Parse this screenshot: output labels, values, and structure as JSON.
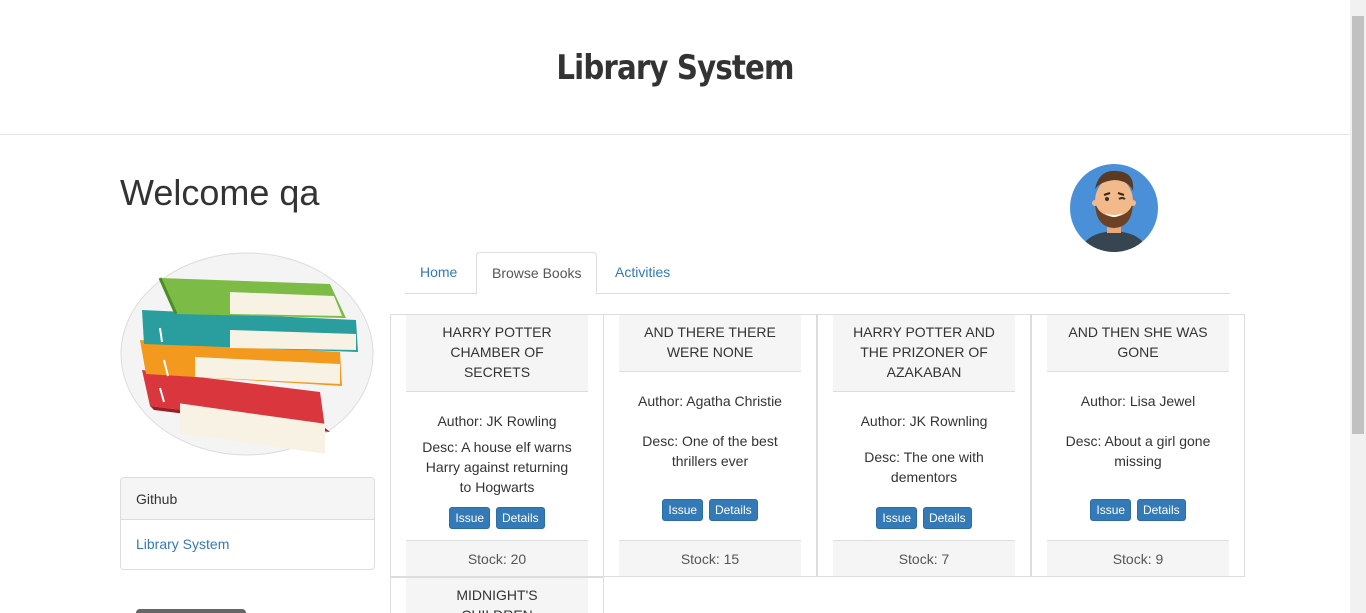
{
  "header": {
    "title": "Library System"
  },
  "welcome": "Welcome qa",
  "tabs": [
    {
      "label": "Home"
    },
    {
      "label": "Browse Books"
    },
    {
      "label": "Activities"
    }
  ],
  "github": {
    "heading": "Github",
    "link": "Library System"
  },
  "books": [
    {
      "title": "HARRY POTTER CHAMBER OF SECRETS",
      "author": "Author: JK Rowling",
      "desc": "Desc: A house elf warns Harry against returning to Hogwarts",
      "issue": "Issue",
      "details": "Details",
      "stock": "Stock: 20"
    },
    {
      "title": "AND THERE THERE WERE NONE",
      "author": "Author: Agatha Christie",
      "desc": "Desc: One of the best thrillers ever",
      "issue": "Issue",
      "details": "Details",
      "stock": "Stock: 15"
    },
    {
      "title": "HARRY POTTER AND THE PRIZONER OF AZAKABAN",
      "author": "Author: JK Rownling",
      "desc": "Desc: The one with dementors",
      "issue": "Issue",
      "details": "Details",
      "stock": "Stock: 7"
    },
    {
      "title": "AND THEN SHE WAS GONE",
      "author": "Author: Lisa Jewel",
      "desc": "Desc: About a girl gone missing",
      "issue": "Issue",
      "details": "Details",
      "stock": "Stock: 9"
    },
    {
      "title": "MIDNIGHT'S CHILDREN"
    }
  ],
  "colors": {
    "link": "#337ab7",
    "button": "#337ab7",
    "panel_bg": "#f5f5f5",
    "avatar_bg": "#4a90d9"
  }
}
